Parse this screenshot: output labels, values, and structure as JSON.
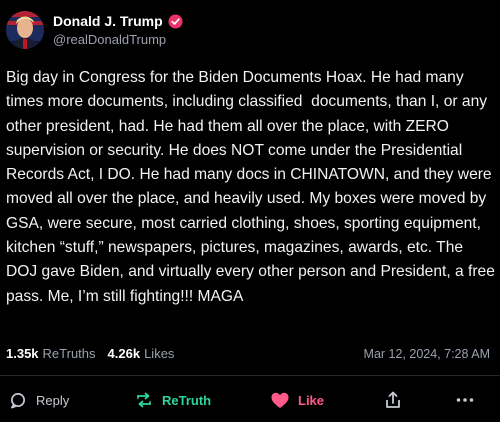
{
  "author": {
    "display_name": "Donald J. Trump",
    "handle": "@realDonaldTrump",
    "verified_color": "#e8336b"
  },
  "post": {
    "text": "Big day in Congress for the Biden Documents Hoax. He had many times more documents, including classified  documents, than I, or any other president, had. He had them all over the place, with ZERO supervision or security. He does NOT come under the Presidential Records Act, I DO. He had many docs in CHINATOWN, and they were moved all over the place, and heavily used. My boxes were moved by GSA, were secure, most carried clothing, shoes, sporting equipment, kitchen “stuff,” newspapers, pictures, magazines, awards, etc. The DOJ gave Biden, and virtually every other person and President, a free pass. Me, I’m still fighting!!! MAGA"
  },
  "stats": {
    "retruths_count": "1.35k",
    "retruths_label": "ReTruths",
    "likes_count": "4.26k",
    "likes_label": "Likes",
    "timestamp": "Mar 12, 2024, 7:28 AM"
  },
  "actions": {
    "reply_label": "Reply",
    "retruth_label": "ReTruth",
    "like_label": "Like",
    "share_icon": "share-icon",
    "more_icon": "more-icon"
  },
  "colors": {
    "background": "#000000",
    "retruth_accent": "#2ed3a0",
    "like_accent": "#ff5a8a",
    "muted": "#9aa0ad"
  }
}
